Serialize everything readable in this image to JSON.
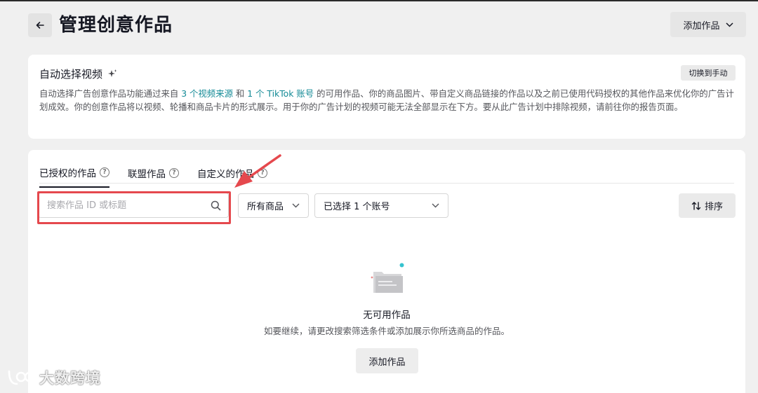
{
  "header": {
    "title": "管理创意作品",
    "add_button_label": "添加作品"
  },
  "auto_select": {
    "title": "自动选择视频",
    "switch_label": "切换到手动",
    "desc_part1": "自动选择广告创意作品功能通过来自 ",
    "link_sources": "3 个视频来源",
    "desc_part2": " 和 ",
    "link_accounts": "1 个 TikTok 账号",
    "desc_part3": " 的可用作品、你的商品图片、带自定义商品链接的作品以及之前已使用代码授权的其他作品来优化你的广告计划成效。你的创意作品将以视频、轮播和商品卡片的形式展示。用于你的广告计划的视频可能无法全部显示在下方。要从此广告计划中排除视频，请前往你的报告页面。"
  },
  "tabs": [
    {
      "label": "已授权的作品",
      "active": true
    },
    {
      "label": "联盟作品",
      "active": false
    },
    {
      "label": "自定义的作品",
      "active": false
    }
  ],
  "filters": {
    "search_placeholder": "搜索作品 ID 或标题",
    "products_select": "所有商品",
    "accounts_select": "已选择 1 个账号",
    "sort_label": "排序"
  },
  "empty_state": {
    "title": "无可用作品",
    "description": "如要继续，请更改搜索筛选条件或添加展示你所选商品的作品。",
    "button_label": "添加作品"
  },
  "watermark": {
    "text": "大数跨境"
  },
  "colors": {
    "link": "#138a96",
    "highlight": "#e5484d",
    "accent_dot": "#36c3cf"
  },
  "icons": [
    "arrow-left-icon",
    "sparkle-icon",
    "help-icon",
    "search-icon",
    "chevron-down-icon",
    "sort-icon",
    "empty-folder-icon"
  ]
}
